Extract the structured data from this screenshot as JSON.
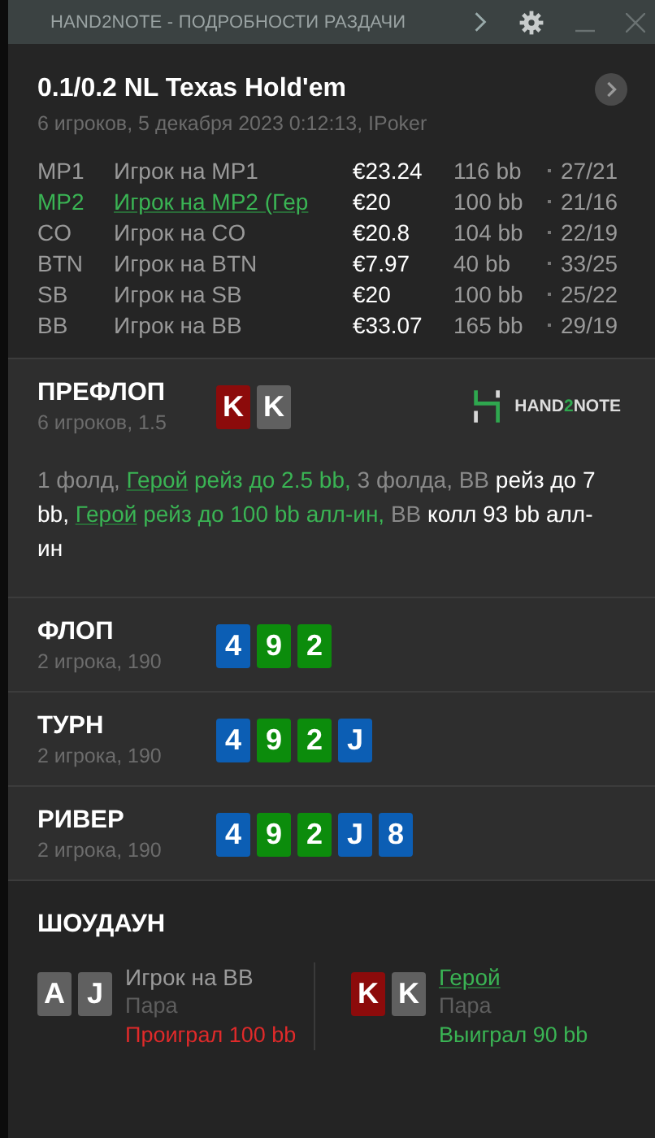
{
  "window": {
    "title": "HAND2NOTE - ПОДРОБНОСТИ РАЗДАЧИ"
  },
  "header": {
    "title": "0.1/0.2 NL Texas Hold'em",
    "subtitle": "6 игроков, 5 декабря 2023 0:12:13, IPoker"
  },
  "players": [
    {
      "position": "MP1",
      "name": "Игрок на MP1",
      "stack": "€23.24",
      "bb": "116 bb",
      "ratio": "27/21",
      "hero": false
    },
    {
      "position": "MP2",
      "name": "Игрок на MP2 (Гер",
      "stack": "€20",
      "bb": "100 bb",
      "ratio": "21/16",
      "hero": true
    },
    {
      "position": "CO",
      "name": "Игрок на CO",
      "stack": "€20.8",
      "bb": "104 bb",
      "ratio": "22/19",
      "hero": false
    },
    {
      "position": "BTN",
      "name": "Игрок на BTN",
      "stack": "€7.97",
      "bb": "40 bb",
      "ratio": "33/25",
      "hero": false
    },
    {
      "position": "SB",
      "name": "Игрок на SB",
      "stack": "€20",
      "bb": "100 bb",
      "ratio": "25/22",
      "hero": false
    },
    {
      "position": "BB",
      "name": "Игрок на BB",
      "stack": "€33.07",
      "bb": "165 bb",
      "ratio": "29/19",
      "hero": false
    }
  ],
  "streets": [
    {
      "name": "ПРЕФЛОП",
      "info": "6 игроков, 1.5",
      "cards": [
        {
          "rank": "K",
          "color": "#8c0b0b"
        },
        {
          "rank": "K",
          "color": "#606060"
        }
      ],
      "logo_text": [
        "HAND",
        "2",
        "NOTE"
      ],
      "actions": [
        {
          "text": "1 фолд, ",
          "kind": "muted"
        },
        {
          "text": "Герой",
          "kind": "hero-name"
        },
        {
          "text": " рейз до 2.5 bb, ",
          "kind": "hero"
        },
        {
          "text": "3 фолда, BB ",
          "kind": "muted"
        },
        {
          "text": "рейз до 7 bb, ",
          "kind": "bold"
        },
        {
          "text": "Герой",
          "kind": "hero-name"
        },
        {
          "text": " рейз до 100 bb алл-ин, ",
          "kind": "hero"
        },
        {
          "text": "BB ",
          "kind": "muted"
        },
        {
          "text": "колл 93 bb алл-ин",
          "kind": "bold"
        }
      ]
    },
    {
      "name": "ФЛОП",
      "info": "2 игрока, 190",
      "cards": [
        {
          "rank": "4",
          "color": "#0c5eb4"
        },
        {
          "rank": "9",
          "color": "#0c8c0c"
        },
        {
          "rank": "2",
          "color": "#0c8c0c"
        }
      ]
    },
    {
      "name": "ТУРН",
      "info": "2 игрока, 190",
      "cards": [
        {
          "rank": "4",
          "color": "#0c5eb4"
        },
        {
          "rank": "9",
          "color": "#0c8c0c"
        },
        {
          "rank": "2",
          "color": "#0c8c0c"
        },
        {
          "rank": "J",
          "color": "#0c5eb4"
        }
      ]
    },
    {
      "name": "РИВЕР",
      "info": "2 игрока, 190",
      "cards": [
        {
          "rank": "4",
          "color": "#0c5eb4"
        },
        {
          "rank": "9",
          "color": "#0c8c0c"
        },
        {
          "rank": "2",
          "color": "#0c8c0c"
        },
        {
          "rank": "J",
          "color": "#0c5eb4"
        },
        {
          "rank": "8",
          "color": "#0c5eb4"
        }
      ]
    }
  ],
  "showdown": {
    "title": "ШОУДАУН",
    "hands": [
      {
        "cards": [
          {
            "rank": "A",
            "color": "#606060"
          },
          {
            "rank": "J",
            "color": "#606060"
          }
        ],
        "name": "Игрок на BB",
        "hero": false,
        "hand": "Пара",
        "result": "Проиграл 100 bb",
        "won": false
      },
      {
        "cards": [
          {
            "rank": "K",
            "color": "#8c0b0b"
          },
          {
            "rank": "K",
            "color": "#606060"
          }
        ],
        "name": "Герой",
        "hero": true,
        "hand": "Пара",
        "result": "Выиграл 90 bb",
        "won": true
      }
    ]
  }
}
